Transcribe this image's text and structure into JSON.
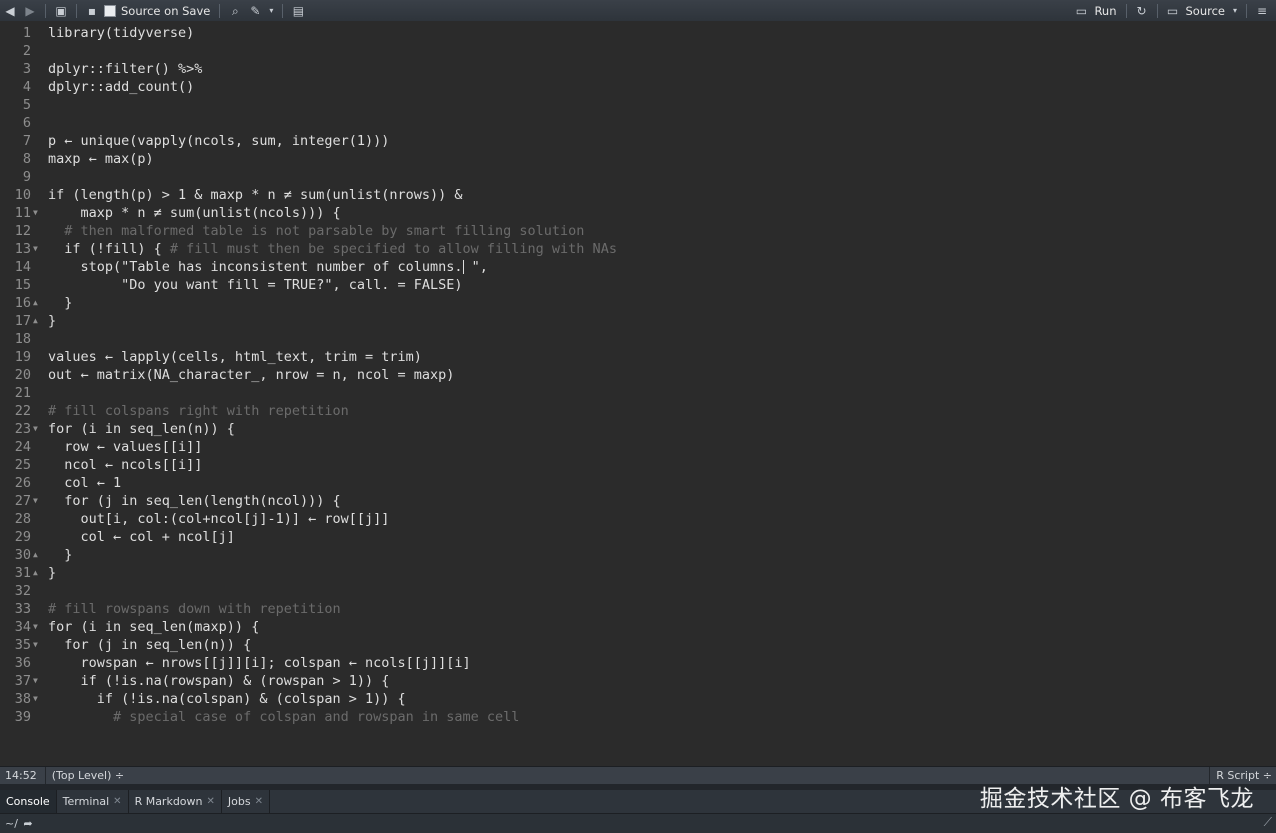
{
  "toolbar": {
    "source_on_save": "Source on Save",
    "run": "Run",
    "source": "Source"
  },
  "editor": {
    "lines": [
      {
        "n": "1",
        "code": "library(tidyverse)"
      },
      {
        "n": "2",
        "code": ""
      },
      {
        "n": "3",
        "code": "dplyr::filter() %>%"
      },
      {
        "n": "4",
        "code": "dplyr::add_count()"
      },
      {
        "n": "5",
        "code": ""
      },
      {
        "n": "6",
        "code": ""
      },
      {
        "n": "7",
        "code": "p ← unique(vapply(ncols, sum, integer(1)))"
      },
      {
        "n": "8",
        "code": "maxp ← max(p)"
      },
      {
        "n": "9",
        "code": ""
      },
      {
        "n": "10",
        "code": "if (length(p) > 1 & maxp * n ≠ sum(unlist(nrows)) &"
      },
      {
        "n": "11",
        "code": "    maxp * n ≠ sum(unlist(ncols))) {",
        "fold": "open"
      },
      {
        "n": "12",
        "code": "  # then malformed table is not parsable by smart filling solution",
        "comment": true
      },
      {
        "n": "13",
        "code": "  if (!fill) { ",
        "comment_part": "# fill must then be specified to allow filling with NAs",
        "fold": "open"
      },
      {
        "n": "14",
        "code": "    stop(\"Table has inconsistent number of columns.",
        "cursor": true,
        "after": " \","
      },
      {
        "n": "15",
        "code": "         \"Do you want fill = TRUE?\", call. = FALSE)"
      },
      {
        "n": "16",
        "code": "  }",
        "fold": "close"
      },
      {
        "n": "17",
        "code": "}",
        "fold": "close"
      },
      {
        "n": "18",
        "code": ""
      },
      {
        "n": "19",
        "code": "values ← lapply(cells, html_text, trim = trim)"
      },
      {
        "n": "20",
        "code": "out ← matrix(NA_character_, nrow = n, ncol = maxp)"
      },
      {
        "n": "21",
        "code": ""
      },
      {
        "n": "22",
        "code": "# fill colspans right with repetition",
        "comment": true
      },
      {
        "n": "23",
        "code": "for (i in seq_len(n)) {",
        "fold": "open"
      },
      {
        "n": "24",
        "code": "  row ← values[[i]]"
      },
      {
        "n": "25",
        "code": "  ncol ← ncols[[i]]"
      },
      {
        "n": "26",
        "code": "  col ← 1"
      },
      {
        "n": "27",
        "code": "  for (j in seq_len(length(ncol))) {",
        "fold": "open"
      },
      {
        "n": "28",
        "code": "    out[i, col:(col+ncol[j]-1)] ← row[[j]]"
      },
      {
        "n": "29",
        "code": "    col ← col + ncol[j]"
      },
      {
        "n": "30",
        "code": "  }",
        "fold": "close"
      },
      {
        "n": "31",
        "code": "}",
        "fold": "close"
      },
      {
        "n": "32",
        "code": ""
      },
      {
        "n": "33",
        "code": "# fill rowspans down with repetition",
        "comment": true
      },
      {
        "n": "34",
        "code": "for (i in seq_len(maxp)) {",
        "fold": "open"
      },
      {
        "n": "35",
        "code": "  for (j in seq_len(n)) {",
        "fold": "open"
      },
      {
        "n": "36",
        "code": "    rowspan ← nrows[[j]][i]; colspan ← ncols[[j]][i]"
      },
      {
        "n": "37",
        "code": "    if (!is.na(rowspan) & (rowspan > 1)) {",
        "fold": "open"
      },
      {
        "n": "38",
        "code": "      if (!is.na(colspan) & (colspan > 1)) {",
        "fold": "open"
      },
      {
        "n": "39",
        "code": "        # special case of colspan and rowspan in same cell",
        "comment": true
      }
    ]
  },
  "status": {
    "position": "14:52",
    "scope": "(Top Level) ÷",
    "file_type": "R Script ÷"
  },
  "tabs": [
    {
      "label": "Console",
      "active": true,
      "closable": false
    },
    {
      "label": "Terminal",
      "active": false,
      "closable": true
    },
    {
      "label": "R Markdown",
      "active": false,
      "closable": true
    },
    {
      "label": "Jobs",
      "active": false,
      "closable": true
    }
  ],
  "console": {
    "path": "~/"
  },
  "watermark": "掘金技术社区 @ 布客飞龙"
}
